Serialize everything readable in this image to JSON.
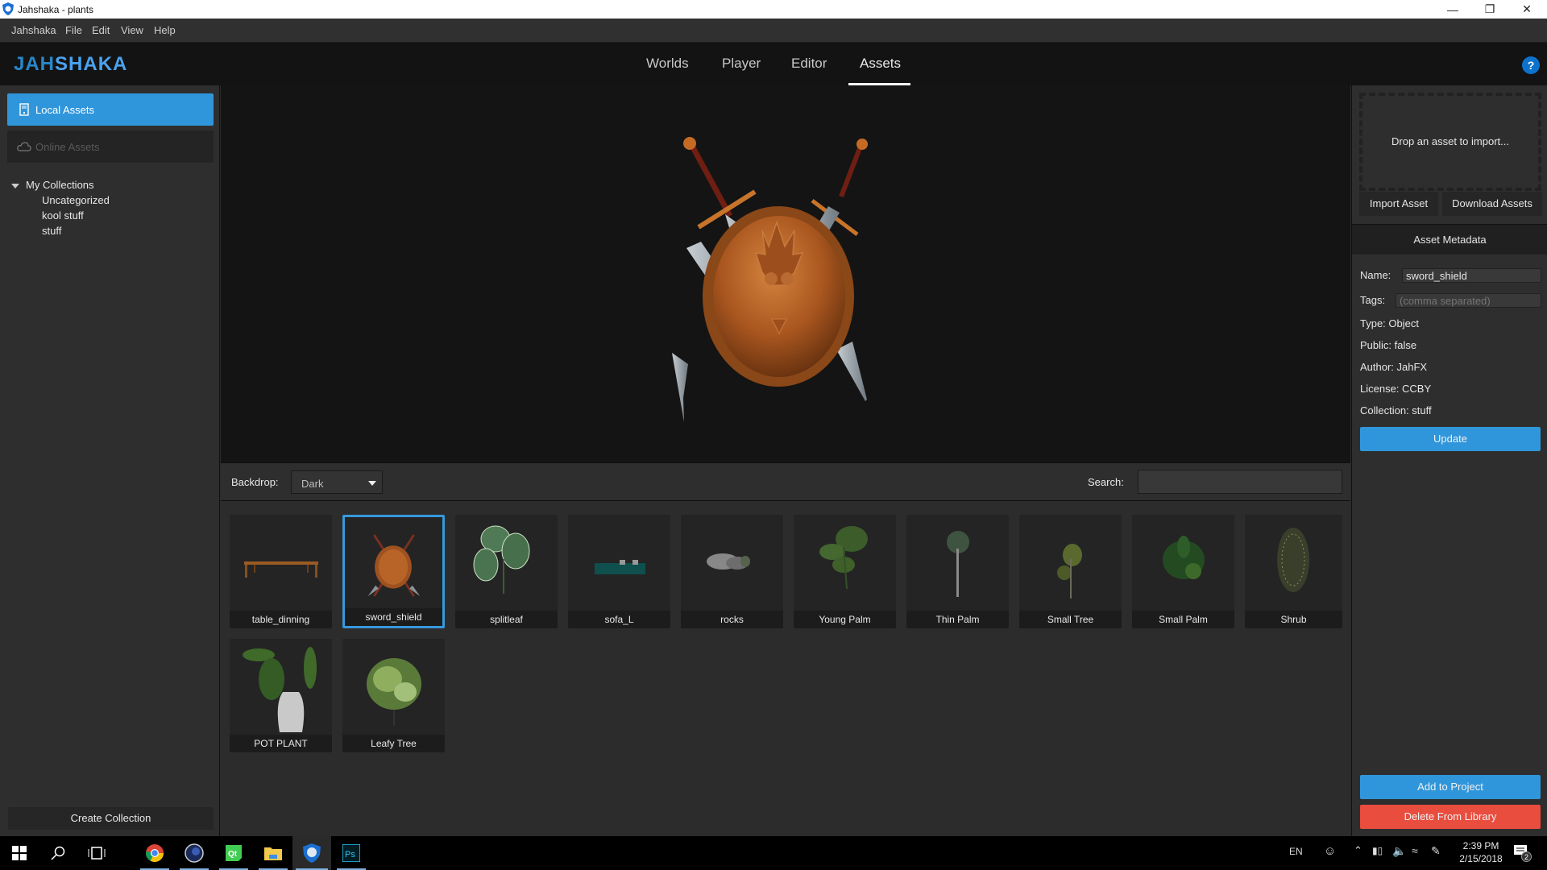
{
  "window": {
    "title": "Jahshaka - plants"
  },
  "menu": [
    "Jahshaka",
    "File",
    "Edit",
    "View",
    "Help"
  ],
  "header": {
    "logo_part1": "JAH",
    "logo_part2": "SHAKA",
    "tabs": [
      {
        "label": "Worlds",
        "active": false
      },
      {
        "label": "Player",
        "active": false
      },
      {
        "label": "Editor",
        "active": false
      },
      {
        "label": "Assets",
        "active": true
      }
    ],
    "help_label": "?"
  },
  "sidebar": {
    "local_assets": "Local Assets",
    "online_assets": "Online Assets",
    "collections_root": "My Collections",
    "collections": [
      "Uncategorized",
      "kool stuff",
      "stuff"
    ],
    "create_collection": "Create Collection"
  },
  "preview": {
    "asset": "sword_shield"
  },
  "toolbar": {
    "backdrop_label": "Backdrop:",
    "backdrop_value": "Dark",
    "search_label": "Search:",
    "search_value": ""
  },
  "assets": [
    {
      "name": "table_dinning",
      "selected": false,
      "thumb": "table"
    },
    {
      "name": "sword_shield",
      "selected": true,
      "thumb": "shield"
    },
    {
      "name": "splitleaf",
      "selected": false,
      "thumb": "splitleaf"
    },
    {
      "name": "sofa_L",
      "selected": false,
      "thumb": "sofa"
    },
    {
      "name": "rocks",
      "selected": false,
      "thumb": "rocks"
    },
    {
      "name": "Young Palm",
      "selected": false,
      "thumb": "youngpalm"
    },
    {
      "name": "Thin Palm",
      "selected": false,
      "thumb": "thinpalm"
    },
    {
      "name": "Small Tree",
      "selected": false,
      "thumb": "smalltree"
    },
    {
      "name": "Small Palm",
      "selected": false,
      "thumb": "smallpalm"
    },
    {
      "name": "Shrub",
      "selected": false,
      "thumb": "shrub"
    },
    {
      "name": "POT PLANT",
      "selected": false,
      "thumb": "potplant"
    },
    {
      "name": "Leafy Tree",
      "selected": false,
      "thumb": "leafytree"
    }
  ],
  "right_panel": {
    "drop_text": "Drop an asset to import...",
    "import_asset": "Import Asset",
    "download_assets": "Download Assets",
    "metadata_header": "Asset Metadata",
    "name_label": "Name:",
    "name_value": "sword_shield",
    "tags_label": "Tags:",
    "tags_placeholder": "(comma separated)",
    "type": "Type: Object",
    "public": "Public: false",
    "author": "Author: JahFX",
    "license": "License: CCBY",
    "collection": "Collection: stuff",
    "update": "Update",
    "add_to_project": "Add to Project",
    "delete_from_library": "Delete From Library"
  },
  "colors": {
    "accent": "#3096db",
    "danger": "#e94d3e",
    "logo_dark": "#2b86c7",
    "logo_light": "#4aa3ee"
  },
  "taskbar": {
    "apps": [
      "start-icon",
      "search-icon",
      "task-view-icon",
      "chrome-icon",
      "cinema4d-icon",
      "qt-icon",
      "file-explorer-icon",
      "jahshaka-icon",
      "photoshop-icon"
    ],
    "language": "EN",
    "time": "2:39 PM",
    "date": "2/15/2018",
    "notifications": "2"
  }
}
